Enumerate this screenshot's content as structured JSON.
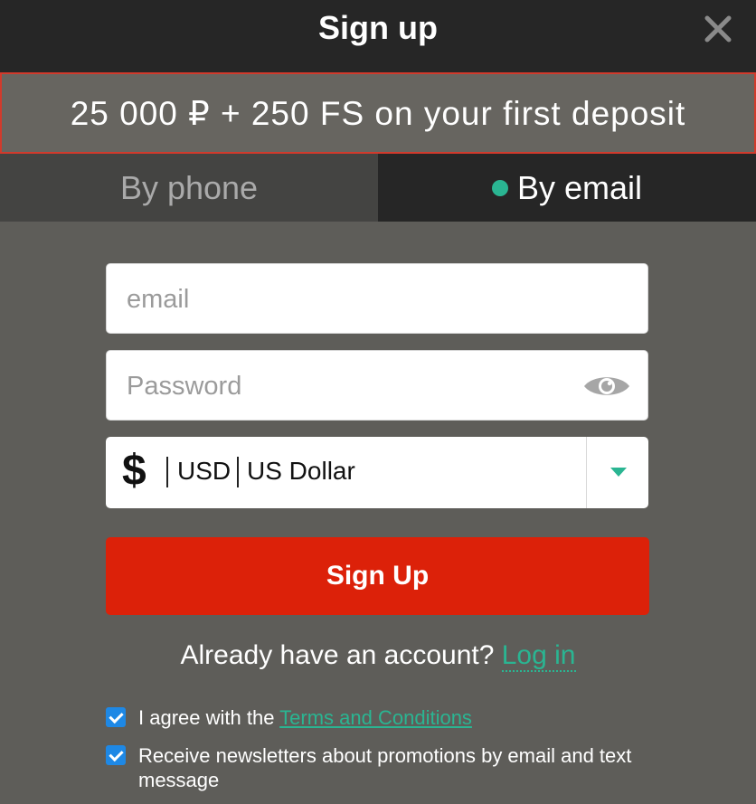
{
  "header": {
    "title": "Sign up",
    "close_icon": "close-icon"
  },
  "promo": {
    "text": "25 000 ₽ + 250 FS on your first deposit"
  },
  "tabs": [
    {
      "label": "By phone",
      "active": false
    },
    {
      "label": "By email",
      "active": true
    }
  ],
  "form": {
    "email_placeholder": "email",
    "email_value": "",
    "password_placeholder": "Password",
    "password_value": "",
    "currency": {
      "symbol": "$",
      "code": "USD",
      "name": "US Dollar"
    },
    "submit_label": "Sign Up"
  },
  "account": {
    "text": "Already have an account?",
    "login_label": "Log in"
  },
  "agreements": {
    "terms_prefix": "I agree with the",
    "terms_link": "Terms and Conditions",
    "terms_checked": true,
    "newsletter_text": "Receive newsletters about promotions by email and text message",
    "newsletter_checked": true
  },
  "colors": {
    "accent": "#2ab592",
    "primary_button": "#dc2109",
    "header_bg": "#262626",
    "body_bg": "#5e5d59",
    "checkbox": "#1e88e5"
  }
}
